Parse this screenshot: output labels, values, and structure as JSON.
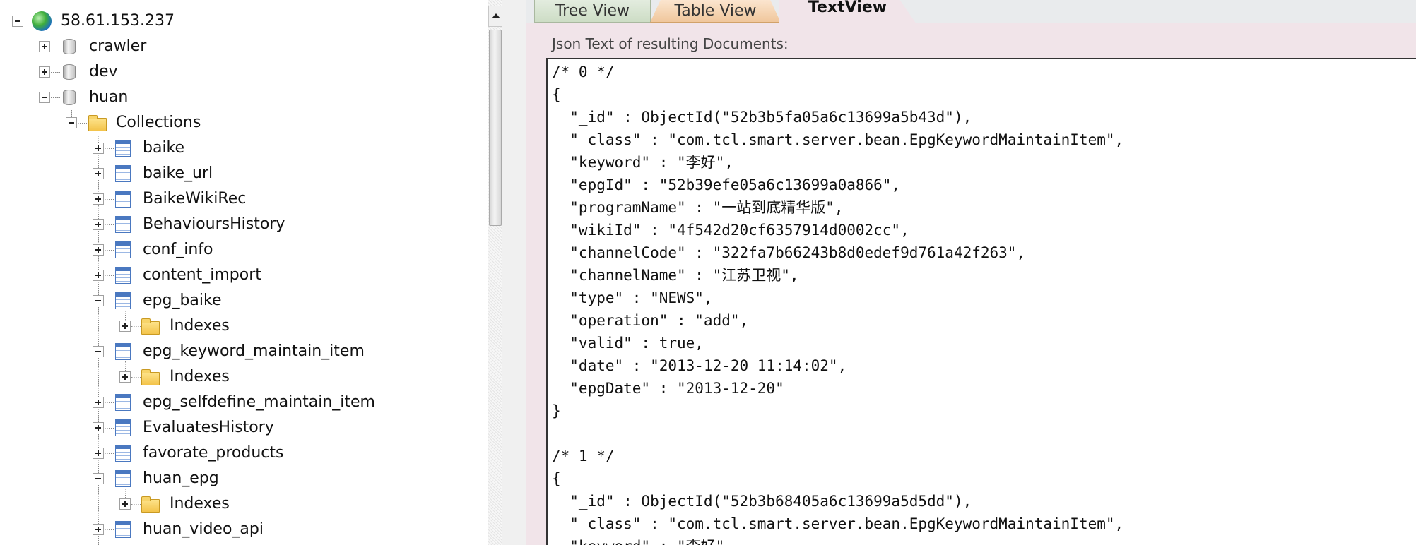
{
  "tree": {
    "server": "58.61.153.237",
    "databases": [
      {
        "name": "crawler",
        "expanded": false
      },
      {
        "name": "dev",
        "expanded": false
      },
      {
        "name": "huan",
        "expanded": true
      }
    ],
    "collections_folder": "Collections",
    "indexes_label": "Indexes",
    "collections": [
      {
        "name": "baike",
        "expanded": false
      },
      {
        "name": "baike_url",
        "expanded": false
      },
      {
        "name": "BaikeWikiRec",
        "expanded": false
      },
      {
        "name": "BehavioursHistory",
        "expanded": false
      },
      {
        "name": "conf_info",
        "expanded": false
      },
      {
        "name": "content_import",
        "expanded": false
      },
      {
        "name": "epg_baike",
        "expanded": true
      },
      {
        "name": "epg_keyword_maintain_item",
        "expanded": true
      },
      {
        "name": "epg_selfdefine_maintain_item",
        "expanded": false
      },
      {
        "name": "EvaluatesHistory",
        "expanded": false
      },
      {
        "name": "favorate_products",
        "expanded": false
      },
      {
        "name": "huan_epg",
        "expanded": true
      },
      {
        "name": "huan_video_api",
        "expanded": false
      }
    ]
  },
  "tabs": [
    {
      "label": "Tree View",
      "active": false
    },
    {
      "label": "Table View",
      "active": false
    },
    {
      "label": "TextView",
      "active": true
    }
  ],
  "caption": "Json Text of resulting Documents:",
  "json_lines": [
    "/* 0 */",
    "{",
    "  \"_id\" : ObjectId(\"52b3b5fa05a6c13699a5b43d\"),",
    "  \"_class\" : \"com.tcl.smart.server.bean.EpgKeywordMaintainItem\",",
    "  \"keyword\" : \"李好\",",
    "  \"epgId\" : \"52b39efe05a6c13699a0a866\",",
    "  \"programName\" : \"一站到底精华版\",",
    "  \"wikiId\" : \"4f542d20cf6357914d0002cc\",",
    "  \"channelCode\" : \"322fa7b66243b8d0edef9d761a42f263\",",
    "  \"channelName\" : \"江苏卫视\",",
    "  \"type\" : \"NEWS\",",
    "  \"operation\" : \"add\",",
    "  \"valid\" : true,",
    "  \"date\" : \"2013-12-20 11:14:02\",",
    "  \"epgDate\" : \"2013-12-20\"",
    "}",
    "",
    "/* 1 */",
    "{",
    "  \"_id\" : ObjectId(\"52b3b68405a6c13699a5d5dd\"),",
    "  \"_class\" : \"com.tcl.smart.server.bean.EpgKeywordMaintainItem\",",
    "  \"keyword\" : \"李好\","
  ],
  "colors": {
    "content_bg": "#f1e4e9",
    "tab_tree": "#cdddc5",
    "tab_table": "#f0c79c"
  }
}
